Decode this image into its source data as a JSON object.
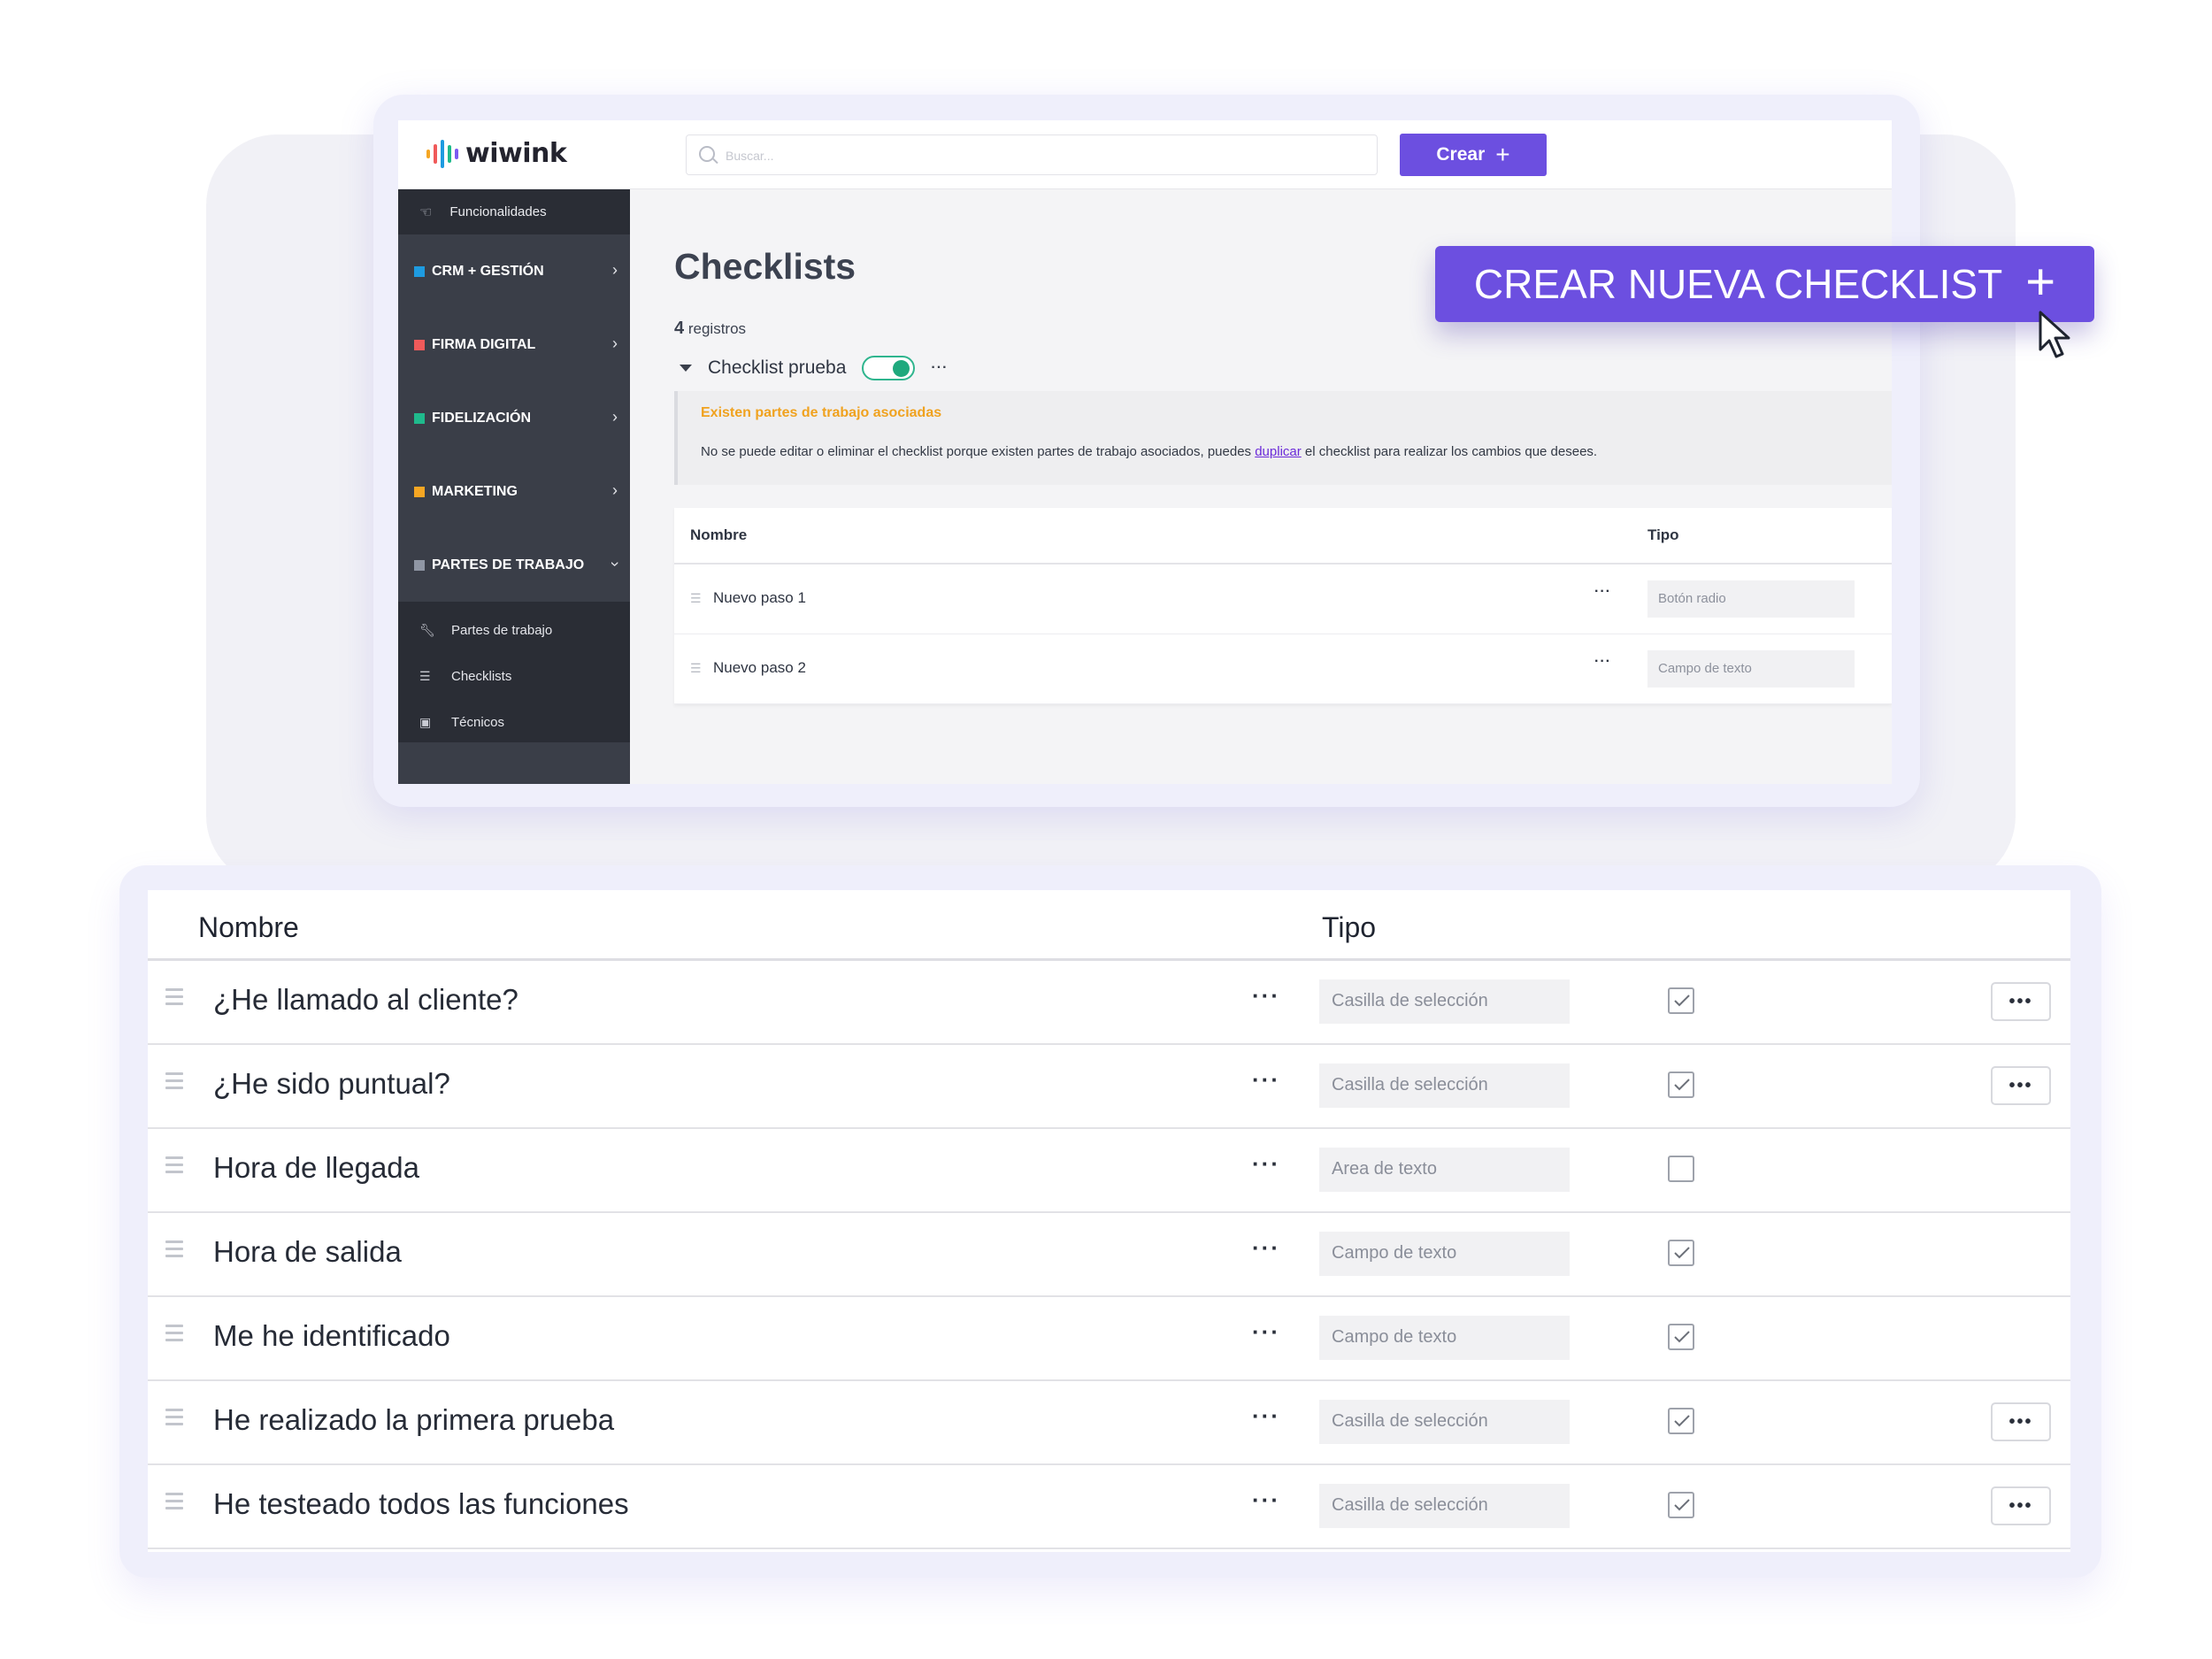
{
  "app": {
    "brand": "wiwink",
    "search_placeholder": "Buscar...",
    "create_label": "Crear",
    "create_icon": "plus-icon"
  },
  "colors": {
    "accent": "#6c4fe0",
    "sidebar_bg": "#3a3e48",
    "sidebar_dark": "#2a2d35",
    "warning": "#f0a21f",
    "toggle_on": "#1fa97d",
    "link": "#6c2bd9"
  },
  "sidebar": {
    "header": "Funcionalidades",
    "items": [
      {
        "label": "CRM + GESTIÓN",
        "color": "#1e9be0",
        "chevron": "chevron-right-icon"
      },
      {
        "label": "FIRMA DIGITAL",
        "color": "#f05a5a",
        "chevron": "chevron-right-icon"
      },
      {
        "label": "FIDELIZACIÓN",
        "color": "#1fba8c",
        "chevron": "chevron-right-icon"
      },
      {
        "label": "MARKETING",
        "color": "#f5a623",
        "chevron": "chevron-right-icon"
      },
      {
        "label": "PARTES DE TRABAJO",
        "color": "#8f96a4",
        "chevron": "chevron-down-icon"
      }
    ],
    "subitems": [
      {
        "label": "Partes de trabajo",
        "icon": "wrench-icon"
      },
      {
        "label": "Checklists",
        "icon": "list-check-icon"
      },
      {
        "label": "Técnicos",
        "icon": "id-card-icon"
      }
    ]
  },
  "main": {
    "title": "Checklists",
    "records_count": "4",
    "records_label": "registros",
    "checklist_name": "Checklist prueba",
    "toggle_on": true,
    "alert": {
      "title": "Existen partes de trabajo asociadas",
      "text_before": "No se puede editar o eliminar el checklist porque existen partes de trabajo asociados, puedes ",
      "link": "duplicar",
      "text_after": " el checklist para realizar los cambios que desees."
    },
    "table": {
      "headers": {
        "name": "Nombre",
        "type": "Tipo"
      },
      "rows": [
        {
          "name": "Nuevo paso 1",
          "type": "Botón radio"
        },
        {
          "name": "Nuevo paso 2",
          "type": "Campo de texto"
        }
      ]
    }
  },
  "cta": {
    "label": "CREAR NUEVA CHECKLIST",
    "icon": "plus-icon"
  },
  "big_table": {
    "headers": {
      "name": "Nombre",
      "type": "Tipo"
    },
    "rows": [
      {
        "name": "¿He llamado al cliente?",
        "type": "Casilla de selección",
        "checked": true,
        "has_menu": true
      },
      {
        "name": "¿He sido puntual?",
        "type": "Casilla de selección",
        "checked": true,
        "has_menu": true
      },
      {
        "name": "Hora de llegada",
        "type": "Area de texto",
        "checked": false,
        "has_menu": false
      },
      {
        "name": "Hora de salida",
        "type": "Campo de texto",
        "checked": true,
        "has_menu": false
      },
      {
        "name": "Me he identificado",
        "type": "Campo de texto",
        "checked": true,
        "has_menu": false
      },
      {
        "name": "He realizado la primera prueba",
        "type": "Casilla de selección",
        "checked": true,
        "has_menu": true
      },
      {
        "name": "He testeado todos las funciones",
        "type": "Casilla de selección",
        "checked": true,
        "has_menu": true
      }
    ]
  }
}
